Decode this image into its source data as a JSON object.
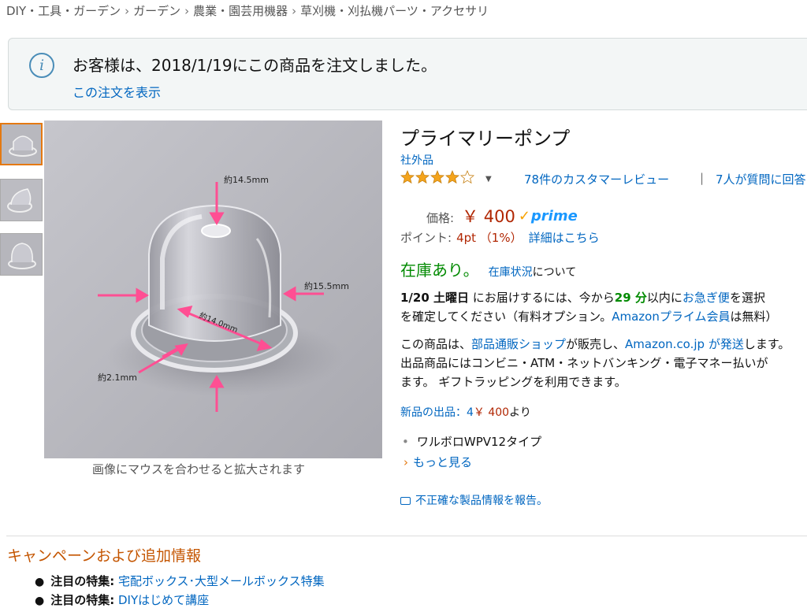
{
  "breadcrumb": [
    "DIY・工具・ガーデン",
    "ガーデン",
    "農業・園芸用機器",
    "草刈機・刈払機パーツ・アクセサリ"
  ],
  "breadcrumb_separator": "›",
  "order_notice": {
    "text": "お客様は、2018/1/19にこの商品を注文しました。",
    "link": "この注文を表示",
    "icon": "info-icon"
  },
  "image_labels": {
    "top": "約14.5mm",
    "right": "約15.5mm",
    "inner": "約14.0mm",
    "bottom": "約2.1mm"
  },
  "image_caption": "画像にマウスを合わせると拡大されます",
  "product": {
    "title": "プライマリーポンプ",
    "brand": "社外品",
    "rating": 4.0,
    "review_link": "78件のカスタマーレビュー",
    "pipe": "|",
    "qa_link": "7人が質問に回答"
  },
  "price": {
    "label": "価格:",
    "value": "￥ 400",
    "prime": "prime"
  },
  "points": {
    "label": "ポイント:",
    "value": "4pt （1%）",
    "link": "詳細はこちら"
  },
  "stock": {
    "status": "在庫あり。",
    "link": "在庫状況",
    "suffix": "について"
  },
  "delivery": {
    "date": "1/20 土曜日",
    "text1": " にお届けするには、今から",
    "minutes": "29 分",
    "text2": "以内に",
    "link1": "お急ぎ便",
    "text3": "を選択",
    "text4": "を確定してください（有料オプション。",
    "link2": "Amazonプライム会員",
    "text5": "は無料）"
  },
  "seller": {
    "text1": "この商品は、",
    "link1": "部品通販ショップ",
    "text2": "が販売し、",
    "link2": "Amazon.co.jp が発送",
    "text3": "します。",
    "line2": "出品商品にはコンビニ・ATM・ネットバンキング・電子マネー払いが",
    "line3": "ます。 ギフトラッピングを利用できます。"
  },
  "offers": {
    "link": "新品の出品：4",
    "price": "￥ 400",
    "suffix": "より"
  },
  "bullet": "ワルボロWPV12タイプ",
  "more": "もっと見る",
  "report": "不正確な製品情報を報告。",
  "campaign": {
    "title": "キャンペーンおよび追加情報",
    "features": [
      {
        "label": "注目の特集:",
        "link": "宅配ボックス･大型メールボックス特集"
      },
      {
        "label": "注目の特集:",
        "link": "DIYはじめて講座"
      }
    ]
  },
  "colors": {
    "link": "#0066c0",
    "price": "#b12704",
    "in_stock": "#008a00",
    "star": "#f4a41c",
    "campaign_title": "#c45500",
    "prime": "#1a98ff"
  }
}
